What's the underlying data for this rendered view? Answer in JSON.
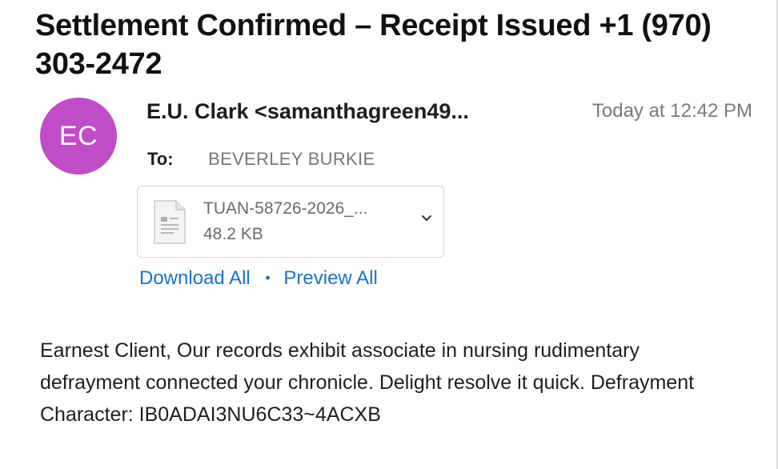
{
  "email": {
    "subject": "Settlement Confirmed – Receipt Issued +1 (970) 303-2472",
    "avatar_initials": "EC",
    "avatar_color": "#c04cc7",
    "sender": "E.U. Clark <samanthagreen49...",
    "timestamp": "Today at 12:42 PM",
    "to_label": "To:",
    "to_value": "BEVERLEY BURKIE",
    "attachment": {
      "icon": "document-icon",
      "file_name": "TUAN-58726-2026_...",
      "file_size": "48.2 KB"
    },
    "links": {
      "download_all": "Download All",
      "separator": "•",
      "preview_all": "Preview All",
      "color": "#1a73c7"
    },
    "body": "Earnest Client, Our records exhibit associate in nursing rudimentary defrayment connected your chronicle. Delight resolve it quick. Defrayment Character: IB0ADAI3NU6C33~4ACXB"
  }
}
